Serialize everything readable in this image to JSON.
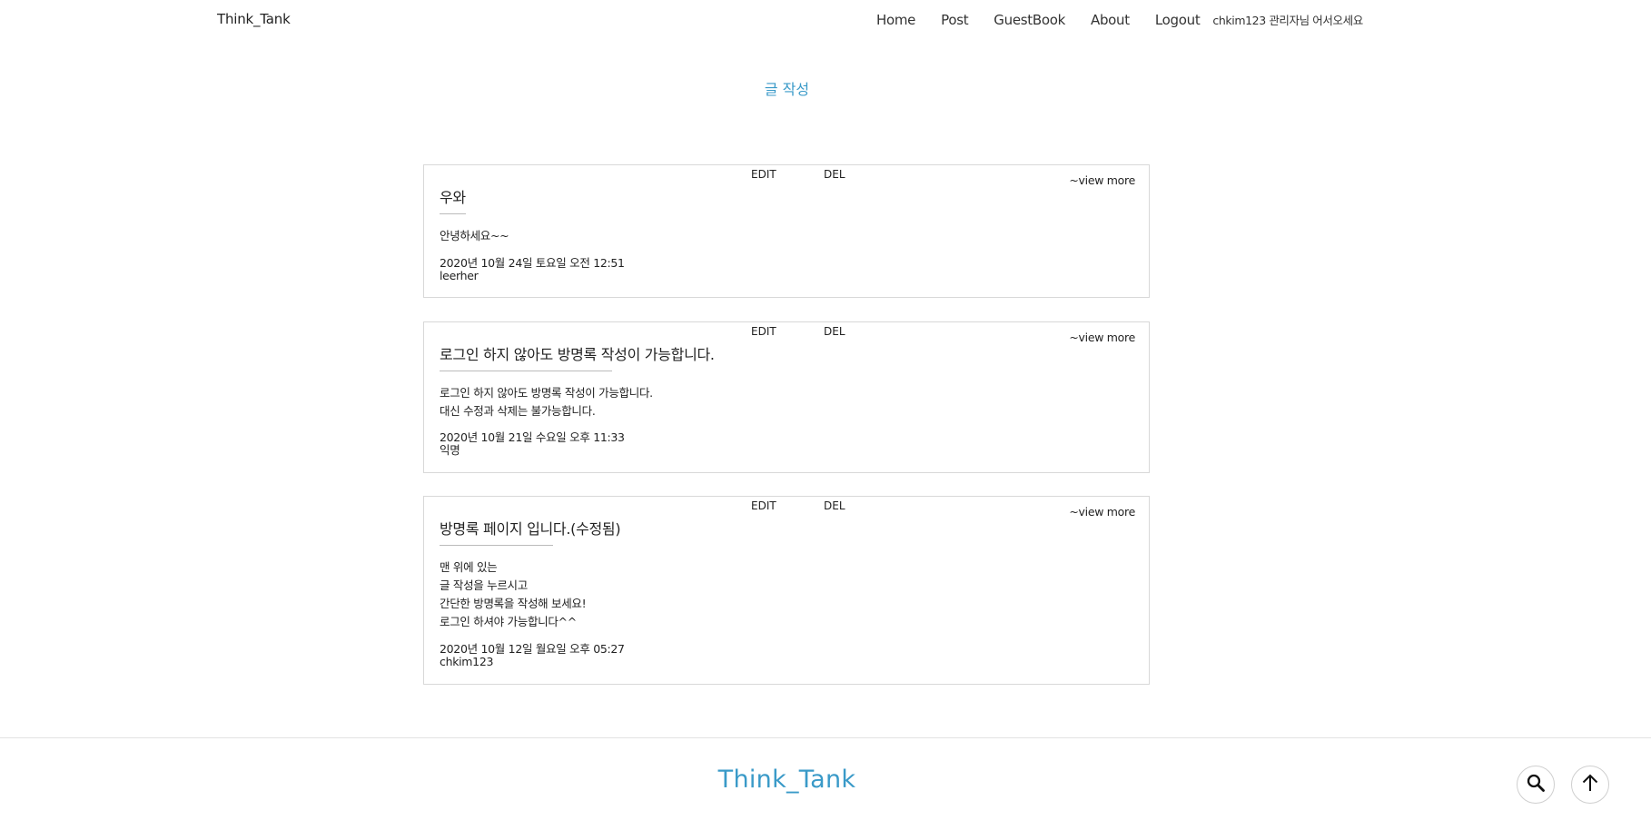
{
  "header": {
    "brand": "Think_Tank",
    "nav": [
      "Home",
      "Post",
      "GuestBook",
      "About",
      "Logout"
    ],
    "welcome": "chkim123 관리자님 어서오세요"
  },
  "main": {
    "write_label": "글 작성",
    "posts": [
      {
        "edit": "EDIT",
        "del": "DEL",
        "view_more": "~view more",
        "title": "우와",
        "content": [
          "안녕하세요~~"
        ],
        "date": "2020년 10월 24일 토요일 오전 12:51",
        "author": "leerher"
      },
      {
        "edit": "EDIT",
        "del": "DEL",
        "view_more": "~view more",
        "title": "로그인 하지 않아도 방명록 작성이 가능합니다.",
        "content": [
          "로그인 하지 않아도 방명록 작성이 가능합니다.",
          "대신 수정과 삭제는 불가능합니다."
        ],
        "date": "2020년 10월 21일 수요일 오후 11:33",
        "author": "익명"
      },
      {
        "edit": "EDIT",
        "del": "DEL",
        "view_more": "~view more",
        "title": "방명록 페이지 입니다.(수정됨)",
        "content": [
          "맨 위에 있는",
          "글 작성을 누르시고",
          "간단한 방명록을 작성해 보세요!",
          "로그인 하셔야 가능합니다^^"
        ],
        "date": "2020년 10월 12일 월요일 오후 05:27",
        "author": "chkim123"
      }
    ]
  },
  "footer": {
    "brand": "Think_Tank",
    "search_icon": "search-icon",
    "top_icon": "arrow-up-icon"
  },
  "colors": {
    "accent": "#3a9ac8",
    "border": "#d8d8d8"
  }
}
